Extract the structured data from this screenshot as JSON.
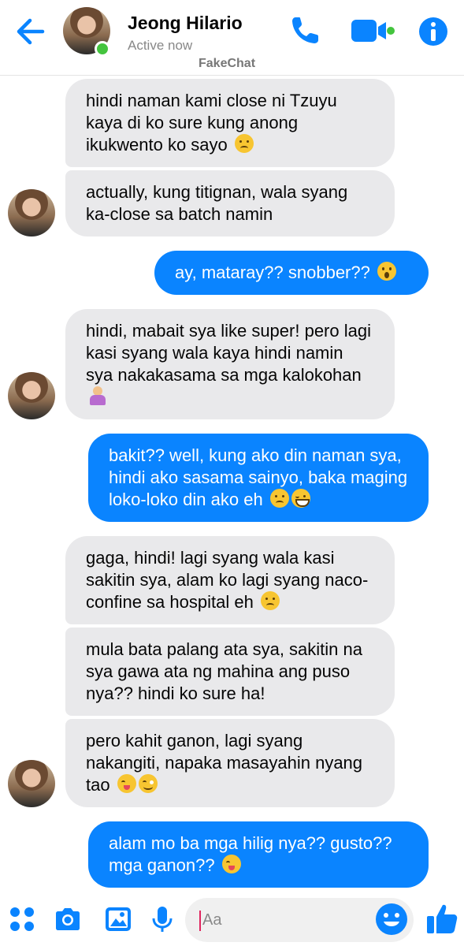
{
  "header": {
    "contact_name": "Jeong Hilario",
    "status": "Active now",
    "app_name": "FakeChat"
  },
  "colors": {
    "accent": "#0a84ff",
    "received_bubble": "#e9e9eb",
    "online": "#44c43e"
  },
  "messages": [
    {
      "from": "them",
      "text": "hindi naman kami close ni Tzuyu kaya di ko sure kung anong ikukwento ko sayo",
      "emoji": [
        "confused-face"
      ]
    },
    {
      "from": "them",
      "text": "actually, kung titignan, wala syang ka-close sa batch namin",
      "emoji": []
    },
    {
      "from": "me",
      "text": "ay, mataray?? snobber??",
      "emoji": [
        "astonished-face"
      ]
    },
    {
      "from": "them",
      "text": "hindi, mabait sya like super! pero lagi kasi syang wala kaya hindi namin sya nakakasama sa mga kalokohan",
      "emoji": [
        "person-shrugging"
      ]
    },
    {
      "from": "me",
      "text": "bakit?? well, kung ako din naman sya, hindi ako sasama sainyo, baka maging loko-loko din ako eh",
      "emoji": [
        "confused-face",
        "grinning-squinting-face"
      ]
    },
    {
      "from": "them",
      "text": "gaga, hindi! lagi syang wala kasi sakitin sya, alam ko lagi syang naco-confine sa hospital eh",
      "emoji": [
        "thinking-face"
      ]
    },
    {
      "from": "them",
      "text": "mula bata palang ata sya, sakitin na sya gawa ata ng mahina ang puso nya?? hindi ko sure ha!",
      "emoji": []
    },
    {
      "from": "them",
      "text": "pero kahit ganon, lagi syang nakangiti, napaka masayahin nyang tao",
      "emoji": [
        "savoring-food-face",
        "smiling-face"
      ]
    },
    {
      "from": "me",
      "text": "alam mo ba mga hilig nya?? gusto?? mga ganon??",
      "emoji": [
        "savoring-food-face"
      ]
    }
  ],
  "composer": {
    "placeholder": "Aa",
    "icons": [
      "apps-icon",
      "camera-icon",
      "gallery-icon",
      "microphone-icon",
      "emoji-icon",
      "like-icon"
    ]
  }
}
